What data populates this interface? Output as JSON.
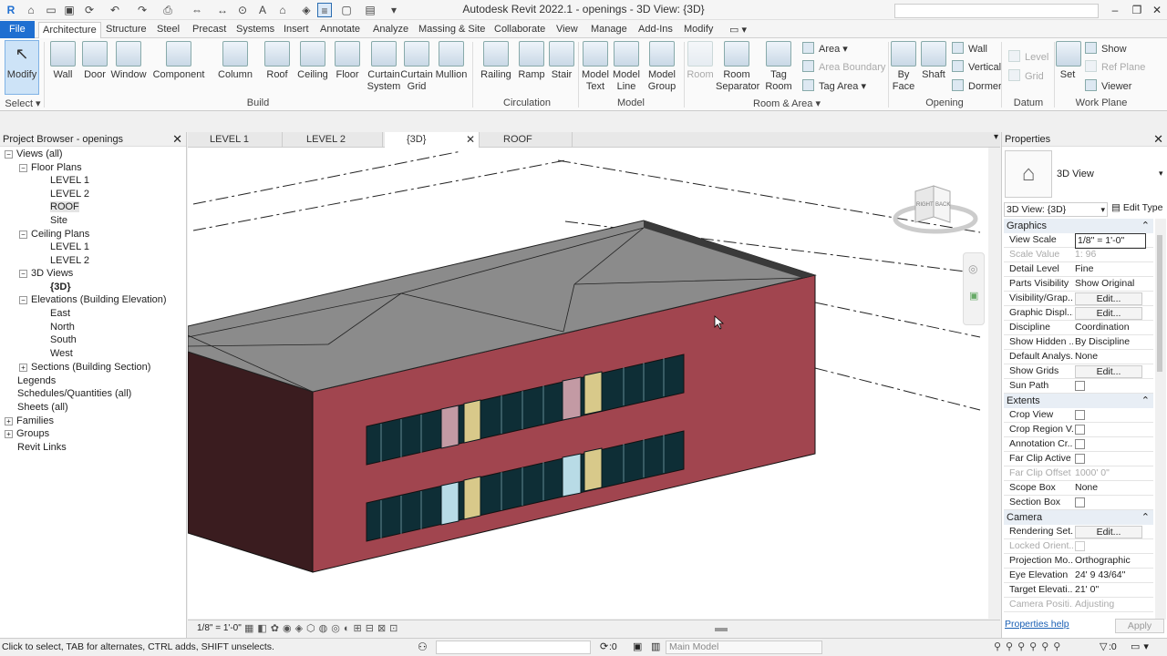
{
  "app": {
    "title": "Autodesk Revit 2022.1 - openings - 3D View: {3D}"
  },
  "ribbon_tabs": [
    "File",
    "Architecture",
    "Structure",
    "Steel",
    "Precast",
    "Systems",
    "Insert",
    "Annotate",
    "Analyze",
    "Massing & Site",
    "Collaborate",
    "View",
    "Manage",
    "Add-Ins",
    "Modify"
  ],
  "ribbon": {
    "modify": "Modify",
    "select": "Select",
    "wall": "Wall",
    "door": "Door",
    "window": "Window",
    "component": "Component",
    "column": "Column",
    "roof": "Roof",
    "ceiling": "Ceiling",
    "floor": "Floor",
    "curtain_system_1": "Curtain",
    "curtain_system_2": "System",
    "curtain_grid_1": "Curtain",
    "curtain_grid_2": "Grid",
    "mullion": "Mullion",
    "railing": "Railing",
    "ramp": "Ramp",
    "stair": "Stair",
    "model_text_1": "Model",
    "model_text_2": "Text",
    "model_line_1": "Model",
    "model_line_2": "Line",
    "model_group_1": "Model",
    "model_group_2": "Group",
    "room": "Room",
    "room_sep_1": "Room",
    "room_sep_2": "Separator",
    "tag_room_1": "Tag",
    "tag_room_2": "Room",
    "area": "Area",
    "area_boundary": "Area  Boundary",
    "tag_area": "Tag  Area",
    "by_face_1": "By",
    "by_face_2": "Face",
    "shaft": "Shaft",
    "wall_small": "Wall",
    "vertical": "Vertical",
    "dormer": "Dormer",
    "level": "Level",
    "grid": "Grid",
    "set": "Set",
    "show": "Show",
    "ref_plane": "Ref  Plane",
    "viewer": "Viewer",
    "panels": {
      "build": "Build",
      "circulation": "Circulation",
      "model": "Model",
      "room_area": "Room & Area",
      "opening": "Opening",
      "datum": "Datum",
      "work_plane": "Work Plane"
    }
  },
  "project_browser": {
    "title": "Project Browser - openings",
    "items": [
      {
        "label": "Views (all)",
        "toggle": "−"
      },
      {
        "label": "Floor Plans",
        "toggle": "−"
      },
      {
        "label": "LEVEL 1",
        "toggle": ""
      },
      {
        "label": "LEVEL 2",
        "toggle": ""
      },
      {
        "label": "ROOF",
        "toggle": ""
      },
      {
        "label": "Site",
        "toggle": ""
      },
      {
        "label": "Ceiling Plans",
        "toggle": "−"
      },
      {
        "label": "LEVEL 1",
        "toggle": ""
      },
      {
        "label": "LEVEL 2",
        "toggle": ""
      },
      {
        "label": "3D Views",
        "toggle": "−"
      },
      {
        "label": "{3D}",
        "toggle": ""
      },
      {
        "label": "Elevations (Building Elevation)",
        "toggle": "−"
      },
      {
        "label": "East",
        "toggle": ""
      },
      {
        "label": "North",
        "toggle": ""
      },
      {
        "label": "South",
        "toggle": ""
      },
      {
        "label": "West",
        "toggle": ""
      },
      {
        "label": "Sections (Building Section)",
        "toggle": "+"
      },
      {
        "label": "Legends",
        "toggle": ""
      },
      {
        "label": "Schedules/Quantities (all)",
        "toggle": ""
      },
      {
        "label": "Sheets (all)",
        "toggle": ""
      },
      {
        "label": "Families",
        "toggle": "+"
      },
      {
        "label": "Groups",
        "toggle": "+"
      },
      {
        "label": "Revit Links",
        "toggle": ""
      }
    ]
  },
  "view_tabs": [
    "LEVEL 1",
    "LEVEL 2",
    "{3D}",
    "ROOF"
  ],
  "viewcube": {
    "right": "RIGHT",
    "back": "BACK"
  },
  "view_control": {
    "scale": "1/8\" = 1'-0\""
  },
  "properties": {
    "title": "Properties",
    "type_name": "3D View",
    "selector": "3D View: {3D}",
    "edit_type": "Edit Type",
    "sections": {
      "graphics": "Graphics",
      "extents": "Extents",
      "camera": "Camera"
    },
    "graphics": [
      {
        "k": "View Scale",
        "v": "1/8\" = 1'-0\""
      },
      {
        "k": "Scale Value",
        "v": "1:  96"
      },
      {
        "k": "Detail Level",
        "v": "Fine"
      },
      {
        "k": "Parts Visibility",
        "v": "Show Original"
      },
      {
        "k": "Visibility/Grap...",
        "v": "Edit..."
      },
      {
        "k": "Graphic Displ...",
        "v": "Edit..."
      },
      {
        "k": "Discipline",
        "v": "Coordination"
      },
      {
        "k": "Show Hidden ...",
        "v": "By Discipline"
      },
      {
        "k": "Default Analys...",
        "v": "None"
      },
      {
        "k": "Show Grids",
        "v": "Edit..."
      },
      {
        "k": "Sun Path",
        "v": ""
      }
    ],
    "extents": [
      {
        "k": "Crop View",
        "v": ""
      },
      {
        "k": "Crop Region V...",
        "v": ""
      },
      {
        "k": "Annotation Cr...",
        "v": ""
      },
      {
        "k": "Far Clip Active",
        "v": ""
      },
      {
        "k": "Far Clip Offset",
        "v": "1000'  0\""
      },
      {
        "k": "Scope Box",
        "v": "None"
      },
      {
        "k": "Section Box",
        "v": ""
      }
    ],
    "camera": [
      {
        "k": "Rendering Set...",
        "v": "Edit..."
      },
      {
        "k": "Locked Orient...",
        "v": ""
      },
      {
        "k": "Projection Mo...",
        "v": "Orthographic"
      },
      {
        "k": "Eye Elevation",
        "v": "24'  9 43/64\""
      },
      {
        "k": "Target Elevati...",
        "v": "21'  0\""
      },
      {
        "k": "Camera Positi...",
        "v": "Adjusting"
      }
    ],
    "help": "Properties help",
    "apply": "Apply"
  },
  "status": {
    "text": "Click to select, TAB for alternates, CTRL adds, SHIFT unselects.",
    "zero": ":0",
    "workset": "Main Model",
    "filter": ":0"
  }
}
